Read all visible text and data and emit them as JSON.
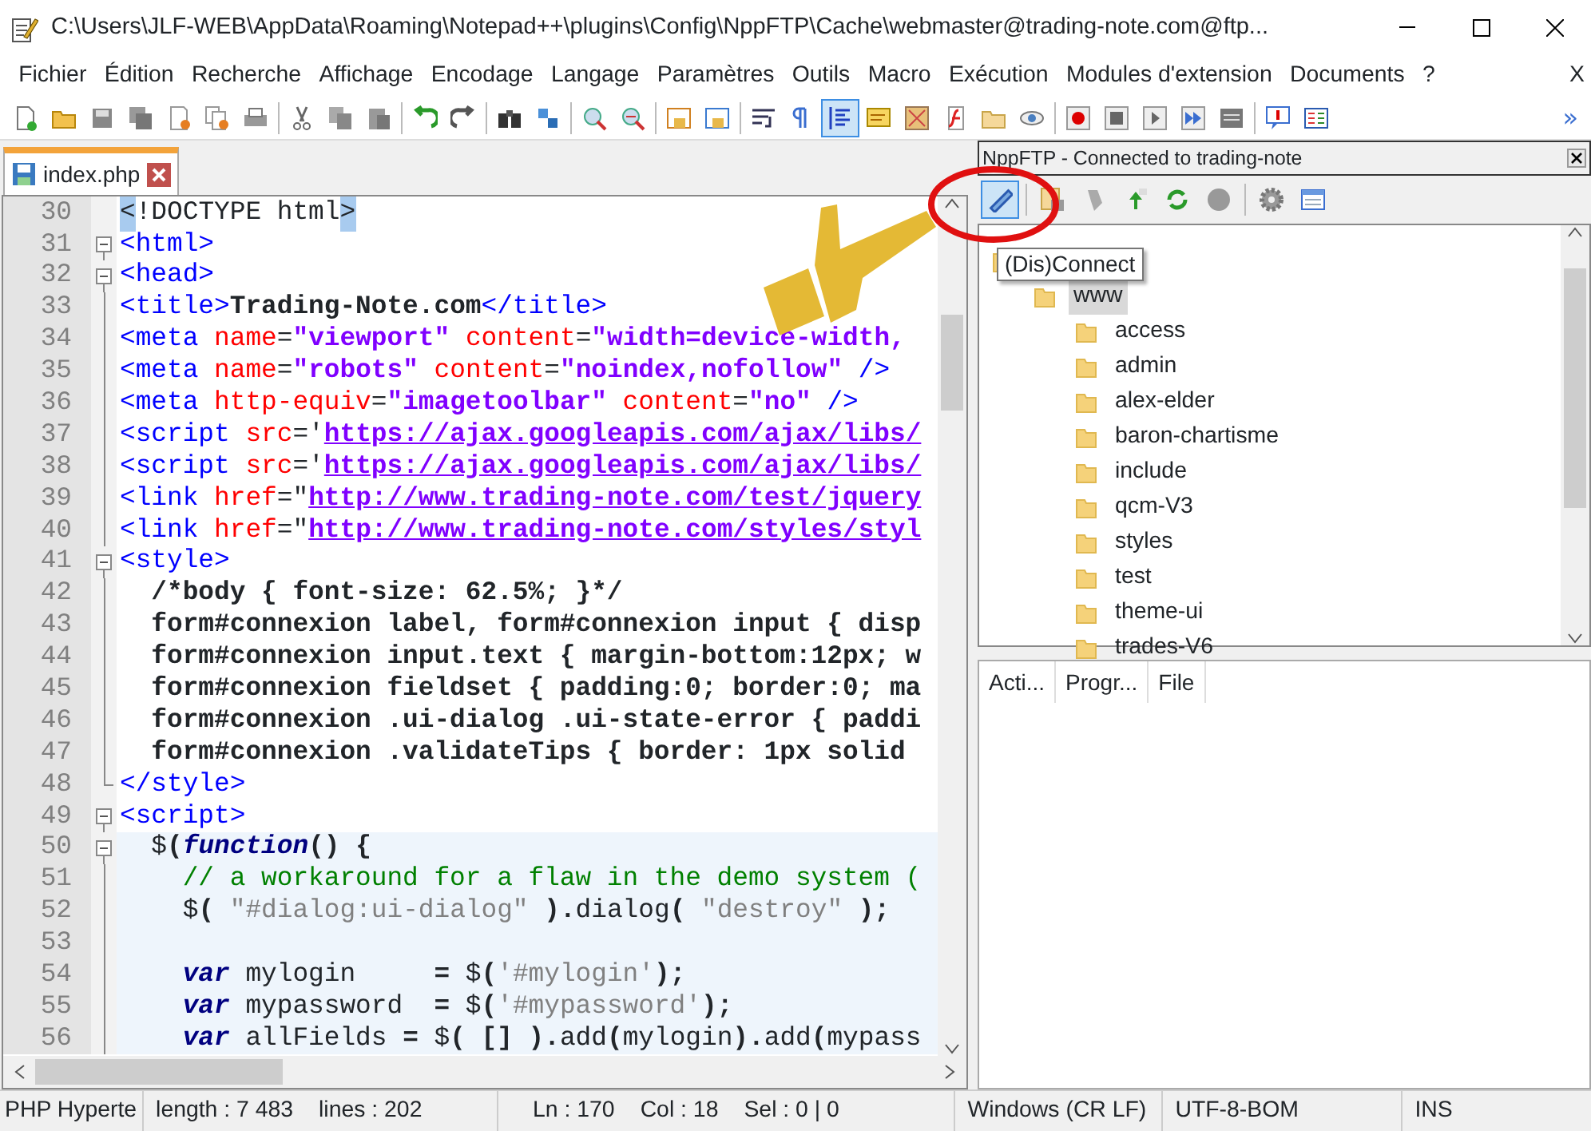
{
  "window": {
    "title": "C:\\Users\\JLF-WEB\\AppData\\Roaming\\Notepad++\\plugins\\Config\\NppFTP\\Cache\\webmaster@trading-note.com@ftp..."
  },
  "menu": {
    "items": [
      "Fichier",
      "Édition",
      "Recherche",
      "Affichage",
      "Encodage",
      "Langage",
      "Paramètres",
      "Outils",
      "Macro",
      "Exécution",
      "Modules d'extension",
      "Documents",
      "?"
    ],
    "close": "X"
  },
  "toolbar": {
    "overflow": "»",
    "buttons": [
      {
        "pressed": false
      },
      {
        "pressed": false
      },
      {
        "pressed": false
      },
      {
        "pressed": false
      },
      {
        "pressed": false
      },
      {
        "pressed": false
      },
      {
        "pressed": false
      },
      {
        "pressed": false
      },
      {
        "pressed": false
      },
      {
        "pressed": false
      },
      {
        "pressed": false
      },
      {
        "pressed": false
      },
      {
        "pressed": false
      },
      {
        "pressed": false
      },
      {
        "pressed": false
      },
      {
        "pressed": false
      },
      {
        "pressed": false
      },
      {
        "pressed": false
      },
      {
        "pressed": false
      },
      {
        "pressed": false
      },
      {
        "pressed": true
      },
      {
        "pressed": false
      },
      {
        "pressed": false
      },
      {
        "pressed": false
      },
      {
        "pressed": false
      },
      {
        "pressed": false
      },
      {
        "pressed": false
      },
      {
        "pressed": false
      },
      {
        "pressed": false
      },
      {
        "pressed": false
      },
      {
        "pressed": false
      },
      {
        "pressed": false
      },
      {
        "pressed": false
      }
    ]
  },
  "tabs": [
    {
      "label": "index.php",
      "selected": true
    }
  ],
  "editor": {
    "lines": [
      {
        "number": "30",
        "kind": "plain",
        "in_block": false,
        "tokens": [
          {
            "kind": "brace",
            "text": "<"
          },
          {
            "kind": "plain",
            "text": "!DOCTYPE html"
          },
          {
            "kind": "brace",
            "text": ">"
          }
        ]
      },
      {
        "number": "31",
        "kind": "fold_start",
        "in_block": false,
        "tokens": [
          {
            "kind": "tag",
            "text": "<html>"
          }
        ]
      },
      {
        "number": "32",
        "kind": "fold_start",
        "in_block": false,
        "tokens": [
          {
            "kind": "tag",
            "text": "<head>"
          }
        ]
      },
      {
        "number": "33",
        "kind": "fold_body",
        "in_block": false,
        "tokens": [
          {
            "kind": "tag",
            "text": "<title>"
          },
          {
            "kind": "bold",
            "text": "Trading-Note.com"
          },
          {
            "kind": "tag",
            "text": "</title>"
          }
        ]
      },
      {
        "number": "34",
        "kind": "fold_body",
        "in_block": false,
        "tokens": [
          {
            "kind": "tag",
            "text": "<meta "
          },
          {
            "kind": "attr",
            "text": "name"
          },
          {
            "kind": "plain",
            "text": "="
          },
          {
            "kind": "value",
            "text": "\"viewport\""
          },
          {
            "kind": "attr",
            "text": " content"
          },
          {
            "kind": "plain",
            "text": "="
          },
          {
            "kind": "value",
            "text": "\"width=device-width,"
          }
        ]
      },
      {
        "number": "35",
        "kind": "fold_body",
        "in_block": false,
        "tokens": [
          {
            "kind": "tag",
            "text": "<meta "
          },
          {
            "kind": "attr",
            "text": "name"
          },
          {
            "kind": "plain",
            "text": "="
          },
          {
            "kind": "value",
            "text": "\"robots\""
          },
          {
            "kind": "attr",
            "text": " content"
          },
          {
            "kind": "plain",
            "text": "="
          },
          {
            "kind": "value",
            "text": "\"noindex,nofollow\""
          },
          {
            "kind": "tag",
            "text": " />"
          }
        ]
      },
      {
        "number": "36",
        "kind": "fold_body",
        "in_block": false,
        "tokens": [
          {
            "kind": "tag",
            "text": "<meta "
          },
          {
            "kind": "attr",
            "text": "http-equiv"
          },
          {
            "kind": "plain",
            "text": "="
          },
          {
            "kind": "value",
            "text": "\"imagetoolbar\""
          },
          {
            "kind": "attr",
            "text": " content"
          },
          {
            "kind": "plain",
            "text": "="
          },
          {
            "kind": "value",
            "text": "\"no\""
          },
          {
            "kind": "tag",
            "text": " />"
          }
        ]
      },
      {
        "number": "37",
        "kind": "fold_body",
        "in_block": false,
        "tokens": [
          {
            "kind": "tag",
            "text": "<script "
          },
          {
            "kind": "attr",
            "text": "src"
          },
          {
            "kind": "plain",
            "text": "='"
          },
          {
            "kind": "url",
            "text": "https://ajax.googleapis.com/ajax/libs/"
          }
        ]
      },
      {
        "number": "38",
        "kind": "fold_body",
        "in_block": false,
        "tokens": [
          {
            "kind": "tag",
            "text": "<script "
          },
          {
            "kind": "attr",
            "text": "src"
          },
          {
            "kind": "plain",
            "text": "='"
          },
          {
            "kind": "url",
            "text": "https://ajax.googleapis.com/ajax/libs/"
          }
        ]
      },
      {
        "number": "39",
        "kind": "fold_body",
        "in_block": false,
        "tokens": [
          {
            "kind": "tag",
            "text": "<link "
          },
          {
            "kind": "attr",
            "text": "href"
          },
          {
            "kind": "plain",
            "text": "=\""
          },
          {
            "kind": "url",
            "text": "http://www.trading-note.com/test/jquery"
          }
        ]
      },
      {
        "number": "40",
        "kind": "fold_body",
        "in_block": false,
        "tokens": [
          {
            "kind": "tag",
            "text": "<link "
          },
          {
            "kind": "attr",
            "text": "href"
          },
          {
            "kind": "plain",
            "text": "=\""
          },
          {
            "kind": "url",
            "text": "http://www.trading-note.com/styles/styl"
          }
        ]
      },
      {
        "number": "41",
        "kind": "fold_start",
        "in_block": false,
        "tokens": [
          {
            "kind": "tag",
            "text": "<style>"
          }
        ]
      },
      {
        "number": "42",
        "kind": "fold_body",
        "in_block": false,
        "tokens": [
          {
            "kind": "bold",
            "text": "  /*body { font-size: 62.5%; }*/"
          }
        ]
      },
      {
        "number": "43",
        "kind": "fold_body",
        "in_block": false,
        "tokens": [
          {
            "kind": "bold",
            "text": "  form#connexion label, form#connexion input { disp"
          }
        ]
      },
      {
        "number": "44",
        "kind": "fold_body",
        "in_block": false,
        "tokens": [
          {
            "kind": "bold",
            "text": "  form#connexion input.text { margin-bottom:12px; w"
          }
        ]
      },
      {
        "number": "45",
        "kind": "fold_body",
        "in_block": false,
        "tokens": [
          {
            "kind": "bold",
            "text": "  form#connexion fieldset { padding:0; border:0; ma"
          }
        ]
      },
      {
        "number": "46",
        "kind": "fold_body",
        "in_block": false,
        "tokens": [
          {
            "kind": "bold",
            "text": "  form#connexion .ui-dialog .ui-state-error { paddi"
          }
        ]
      },
      {
        "number": "47",
        "kind": "fold_body",
        "in_block": false,
        "tokens": [
          {
            "kind": "bold",
            "text": "  form#connexion .validateTips { border: 1px solid"
          }
        ]
      },
      {
        "number": "48",
        "kind": "fold_end",
        "in_block": false,
        "tokens": [
          {
            "kind": "tag",
            "text": "</style>"
          }
        ]
      },
      {
        "number": "49",
        "kind": "fold_start",
        "in_block": false,
        "tokens": [
          {
            "kind": "tag",
            "text": "<script>"
          }
        ]
      },
      {
        "number": "50",
        "kind": "fold_start",
        "in_block": true,
        "tokens": [
          {
            "kind": "plain",
            "text": "  $"
          },
          {
            "kind": "op",
            "text": "("
          },
          {
            "kind": "keyword",
            "text": "function"
          },
          {
            "kind": "op",
            "text": "() {"
          }
        ]
      },
      {
        "number": "51",
        "kind": "fold_body",
        "in_block": true,
        "tokens": [
          {
            "kind": "comment",
            "text": "    // a workaround for a flaw in the demo system ("
          }
        ]
      },
      {
        "number": "52",
        "kind": "fold_body",
        "in_block": true,
        "tokens": [
          {
            "kind": "plain",
            "text": "    $"
          },
          {
            "kind": "op",
            "text": "( "
          },
          {
            "kind": "jsstr",
            "text": "\"#dialog:ui-dialog\""
          },
          {
            "kind": "op",
            "text": " )."
          },
          {
            "kind": "plain",
            "text": "dialog"
          },
          {
            "kind": "op",
            "text": "( "
          },
          {
            "kind": "jsstr",
            "text": "\"destroy\""
          },
          {
            "kind": "op",
            "text": " );"
          }
        ]
      },
      {
        "number": "53",
        "kind": "fold_body",
        "in_block": true
      },
      {
        "number": "54",
        "kind": "fold_body",
        "in_block": true,
        "tokens": [
          {
            "kind": "keyword",
            "text": "    var"
          },
          {
            "kind": "plain",
            "text": " mylogin     "
          },
          {
            "kind": "op",
            "text": "="
          },
          {
            "kind": "plain",
            "text": " $"
          },
          {
            "kind": "op",
            "text": "("
          },
          {
            "kind": "jsstr",
            "text": "'#mylogin'"
          },
          {
            "kind": "op",
            "text": ");"
          }
        ]
      },
      {
        "number": "55",
        "kind": "fold_body",
        "in_block": true,
        "tokens": [
          {
            "kind": "keyword",
            "text": "    var"
          },
          {
            "kind": "plain",
            "text": " mypassword  "
          },
          {
            "kind": "op",
            "text": "="
          },
          {
            "kind": "plain",
            "text": " $"
          },
          {
            "kind": "op",
            "text": "("
          },
          {
            "kind": "jsstr",
            "text": "'#mypassword'"
          },
          {
            "kind": "op",
            "text": ");"
          }
        ]
      },
      {
        "number": "56",
        "kind": "fold_body",
        "in_block": true,
        "tokens": [
          {
            "kind": "keyword",
            "text": "    var"
          },
          {
            "kind": "plain",
            "text": " allFields "
          },
          {
            "kind": "op",
            "text": "="
          },
          {
            "kind": "plain",
            "text": " $"
          },
          {
            "kind": "op",
            "text": "( [] )."
          },
          {
            "kind": "plain",
            "text": "add"
          },
          {
            "kind": "op",
            "text": "("
          },
          {
            "kind": "plain",
            "text": "mylogin"
          },
          {
            "kind": "op",
            "text": ")."
          },
          {
            "kind": "plain",
            "text": "add"
          },
          {
            "kind": "op",
            "text": "("
          },
          {
            "kind": "plain",
            "text": "mypass"
          }
        ]
      }
    ]
  },
  "ftp_panel": {
    "title": "NppFTP - Connected to trading-note",
    "toolbar": [
      {
        "pressed": true
      },
      {
        "pressed": false
      },
      {
        "pressed": false
      },
      {
        "pressed": false
      },
      {
        "pressed": false
      },
      {
        "pressed": false
      },
      {
        "pressed": false
      },
      {
        "pressed": false
      }
    ],
    "tooltip": "(Dis)Connect",
    "tree": [
      {
        "children": [
          {
            "label": "www",
            "selected": true,
            "children": [
              {
                "label": "access",
                "selected": false
              },
              {
                "label": "admin",
                "selected": false
              },
              {
                "label": "alex-elder",
                "selected": false
              },
              {
                "label": "baron-chartisme",
                "selected": false
              },
              {
                "label": "include",
                "selected": false
              },
              {
                "label": "qcm-V3",
                "selected": false
              },
              {
                "label": "styles",
                "selected": false
              },
              {
                "label": "test",
                "selected": false
              },
              {
                "label": "theme-ui",
                "selected": false
              },
              {
                "label": "trades-V6",
                "selected": false
              }
            ]
          }
        ]
      }
    ],
    "queue_columns": [
      "Acti...",
      "Progr...",
      "File"
    ]
  },
  "status_bar": [
    "PHP Hyperte",
    "length : 7 483",
    "lines : 202",
    "Ln : 170",
    "Col : 18",
    "Sel : 0 | 0",
    "Windows (CR LF)",
    "UTF-8-BOM",
    "INS"
  ]
}
